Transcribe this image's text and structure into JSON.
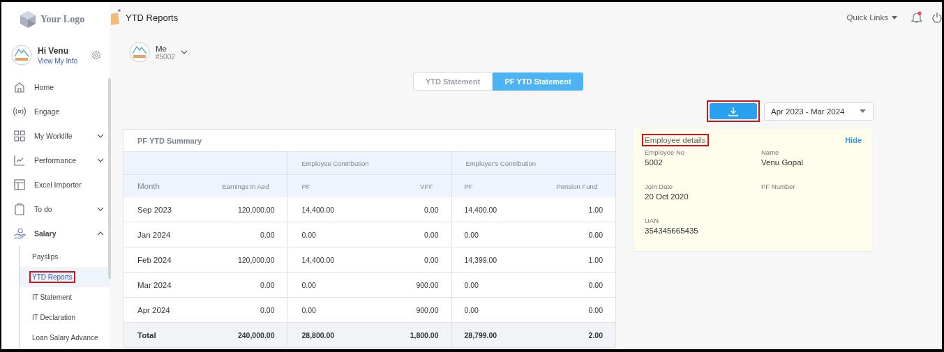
{
  "logo": {
    "text": "Your Logo"
  },
  "user": {
    "greeting": "Hi Venu",
    "link": "View My Info"
  },
  "sidebar": {
    "items": [
      {
        "label": "Home",
        "kind": "link"
      },
      {
        "label": "Engage",
        "kind": "link"
      },
      {
        "label": "My Worklife",
        "kind": "group",
        "expanded": false
      },
      {
        "label": "Performance",
        "kind": "group",
        "expanded": false
      },
      {
        "label": "Excel Importer",
        "kind": "link"
      },
      {
        "label": "To do",
        "kind": "group",
        "expanded": false
      },
      {
        "label": "Salary",
        "kind": "group",
        "expanded": true,
        "children": [
          {
            "label": "Payslips",
            "selected": false,
            "highlighted": false
          },
          {
            "label": "YTD Reports",
            "selected": true,
            "highlighted": true
          },
          {
            "label": "IT Statement",
            "selected": false,
            "highlighted": false
          },
          {
            "label": "IT Declaration",
            "selected": false,
            "highlighted": false
          },
          {
            "label": "Loan Salary Advance",
            "selected": false,
            "highlighted": false
          }
        ]
      }
    ]
  },
  "header": {
    "title": "YTD Reports",
    "quick_links": "Quick Links",
    "notification": true
  },
  "employee_selector": {
    "name": "Me",
    "id": "#5002"
  },
  "tabs": [
    {
      "label": "YTD Statement",
      "selected": false
    },
    {
      "label": "PF YTD Statement",
      "selected": true
    }
  ],
  "download_button": {
    "highlighted": true
  },
  "period_dropdown": {
    "value": "Apr 2023 - Mar 2024"
  },
  "table": {
    "title": "PF YTD Summary",
    "groups": [
      "Employee Contribution",
      "Employer's Contribution"
    ],
    "columns": [
      "Month",
      "Earnings In Aed",
      "PF",
      "VPF",
      "PF",
      "Pension Fund"
    ],
    "rows": [
      {
        "kind": "data",
        "cells": [
          "Sep 2023",
          "120,000.00",
          "14,400.00",
          "0.00",
          "14,400.00",
          "1.00"
        ]
      },
      {
        "kind": "data",
        "cells": [
          "Jan 2024",
          "0.00",
          "0.00",
          "0.00",
          "0.00",
          "0.00"
        ]
      },
      {
        "kind": "data",
        "cells": [
          "Feb 2024",
          "120,000.00",
          "14,400.00",
          "0.00",
          "14,399.00",
          "1.00"
        ]
      },
      {
        "kind": "data",
        "cells": [
          "Mar 2024",
          "0.00",
          "0.00",
          "900.00",
          "0.00",
          "0.00"
        ]
      },
      {
        "kind": "data",
        "cells": [
          "Apr 2024",
          "0.00",
          "0.00",
          "900.00",
          "0.00",
          "0.00"
        ]
      },
      {
        "kind": "total",
        "cells": [
          "Total",
          "240,000.00",
          "28,800.00",
          "1,800.00",
          "28,799.00",
          "2.00"
        ]
      }
    ]
  },
  "employee_details": {
    "title": "Employee details",
    "highlighted": true,
    "hide": "Hide",
    "fields": [
      {
        "label": "Employee No",
        "value": "5002"
      },
      {
        "label": "Name",
        "value": "Venu Gopal"
      },
      {
        "label": "Join Date",
        "value": "20 Oct 2020"
      },
      {
        "label": "PF Number"
      },
      {
        "label": "UAN",
        "value": "354345665435"
      }
    ]
  }
}
